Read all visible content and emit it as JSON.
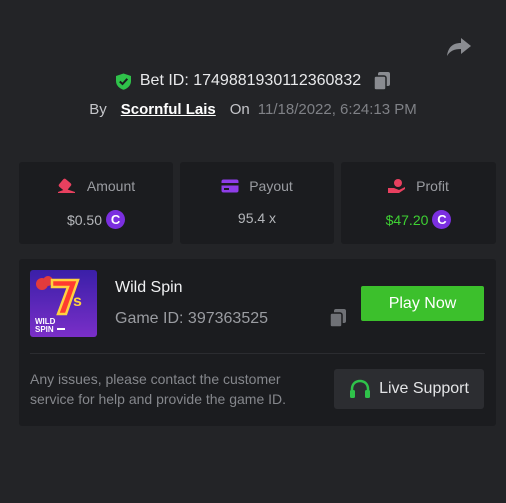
{
  "header": {
    "bet_label": "Bet ID:",
    "bet_id": "1749881930112360832",
    "by_label": "By",
    "username": "Scornful Lais",
    "on_label": "On",
    "date": "11/18/2022, 6:24:13 PM"
  },
  "stats": [
    {
      "title": "Amount",
      "value": "$0.50",
      "coin": true
    },
    {
      "title": "Payout",
      "value": "95.4 x",
      "coin": false
    },
    {
      "title": "Profit",
      "value": "$47.20",
      "coin": true
    }
  ],
  "game": {
    "name": "Wild Spin",
    "id_label": "Game ID:",
    "id": "397363525",
    "thumb_text": "WILD SPIN",
    "thumb_big": "7s",
    "play_label": "Play Now"
  },
  "support": {
    "message": "Any issues, please contact the customer service for help and provide the game ID.",
    "button_label": "Live Support"
  },
  "coin_symbol": "C",
  "colors": {
    "accent_green": "#3cc02c",
    "coin_purple": "#7b2fe0",
    "background": "#232427",
    "card": "#1b1c1f"
  }
}
